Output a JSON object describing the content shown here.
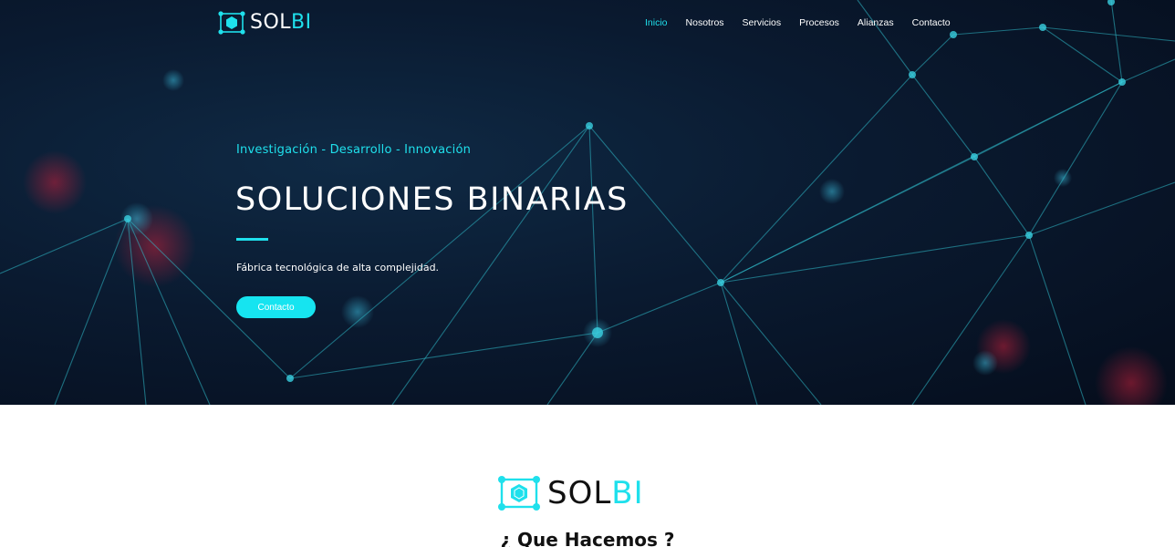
{
  "header": {
    "logo_text_main": "SOL",
    "logo_text_accent": "BI",
    "nav": [
      {
        "label": "Inicio",
        "active": true
      },
      {
        "label": "Nosotros",
        "active": false
      },
      {
        "label": "Servicios",
        "active": false
      },
      {
        "label": "Procesos",
        "active": false
      },
      {
        "label": "Alianzas",
        "active": false
      },
      {
        "label": "Contacto",
        "active": false
      }
    ]
  },
  "hero": {
    "tagline": "Investigación - Desarrollo - Innovación",
    "title": "SOLUCIONES BINARIAS",
    "subtitle": "Fábrica tecnológica de alta complejidad.",
    "cta_label": "Contacto"
  },
  "about": {
    "brand_main": "SOL",
    "brand_accent": "BI",
    "heading": "¿ Que Hacemos ?"
  },
  "colors": {
    "accent": "#1fe0ec",
    "hero_bg": "#0a1a30",
    "text_dark": "#111111"
  },
  "icons": [
    "logo-hex-icon",
    "brand-hex-icon"
  ]
}
